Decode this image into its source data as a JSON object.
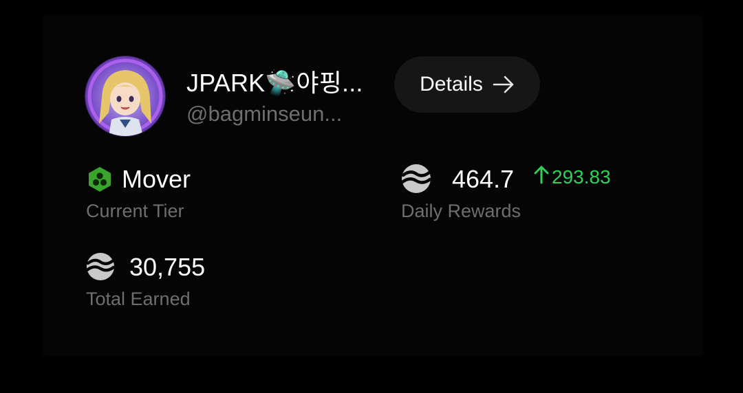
{
  "profile": {
    "display_name": "JPARK🛸야핑...",
    "handle": "@bagminseun..."
  },
  "actions": {
    "details_label": "Details"
  },
  "stats": {
    "tier": {
      "value": "Mover",
      "label": "Current Tier",
      "icon": "tier-hexagon-icon"
    },
    "daily_rewards": {
      "value": "464.7",
      "label": "Daily Rewards",
      "change": "293.83",
      "change_direction": "up",
      "icon": "token-logo-icon"
    },
    "total_earned": {
      "value": "30,755",
      "label": "Total Earned",
      "icon": "token-logo-icon"
    }
  },
  "colors": {
    "background": "#000000",
    "card": "#050505",
    "button": "#161616",
    "muted_text": "#6e6e6e",
    "positive": "#2ed158",
    "tier_green": "#3aa52c"
  }
}
